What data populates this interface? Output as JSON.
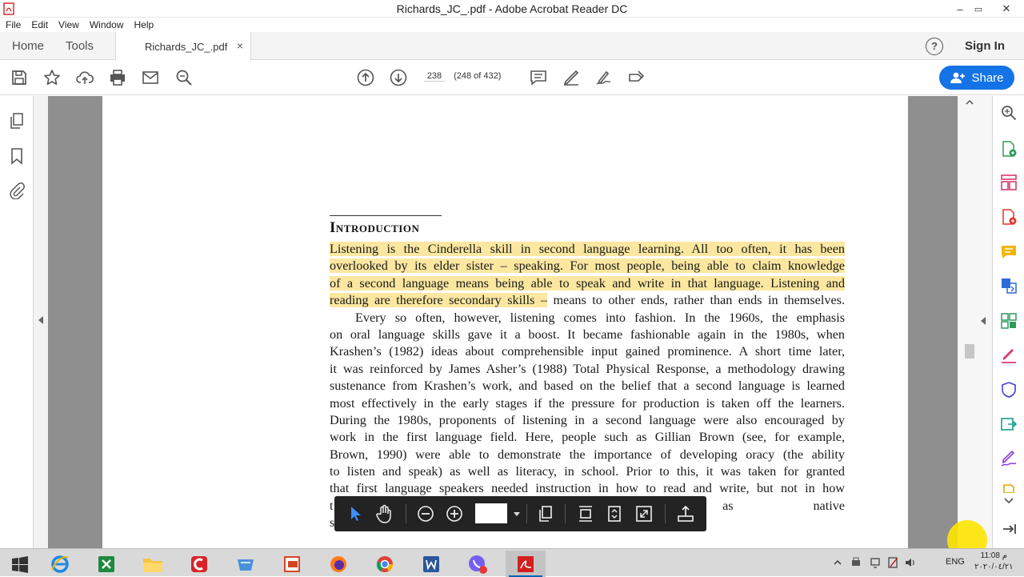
{
  "window": {
    "title": "Richards_JC_.pdf - Adobe Acrobat Reader DC",
    "min_glyph": "–",
    "max_glyph": "▭",
    "close_glyph": "✕"
  },
  "menu": [
    "File",
    "Edit",
    "View",
    "Window",
    "Help"
  ],
  "tabs": {
    "home": "Home",
    "tools": "Tools",
    "doc": "Richards_JC_.pdf",
    "close_glyph": "×"
  },
  "header": {
    "help_glyph": "?",
    "signin": "Sign In",
    "share": "Share"
  },
  "toolbar": {
    "page_current": "238",
    "page_total": "(248 of 432)"
  },
  "document": {
    "heading": "Introduction",
    "lines": [
      {
        "t": "Listening is the Cinderella skill in second language learning. All too often, it has been",
        "hl": true
      },
      {
        "t": "overlooked by its elder sister – speaking. For most people, being able to claim knowledge",
        "hl": true
      },
      {
        "t": "of a second language means being able to speak and write in that language. Listening and",
        "hl": true
      },
      {
        "t": "reading are therefore secondary skills –",
        "hl": true,
        "rest": " means to other ends, rather than ends in themselves."
      },
      {
        "t": "Every so often, however, listening comes into fashion. In the 1960s, the emphasis",
        "indent": true
      },
      {
        "t": "on oral language skills gave it a boost. It became fashionable again in the 1980s, when"
      },
      {
        "t": "Krashen’s (1982) ideas about comprehensible input gained prominence. A short time later,"
      },
      {
        "t": "it was reinforced by James Asher’s (1988) Total Physical Response, a methodology drawing"
      },
      {
        "t": "sustenance from Krashen’s work, and based on the belief that a second language is learned"
      },
      {
        "t": "most effectively in the early stages if the pressure for production is taken off the learners."
      },
      {
        "t": "During the 1980s, proponents of listening in a second language were also encouraged by"
      },
      {
        "t": "work in the first language field. Here, people such as Gillian Brown (see, for example,"
      },
      {
        "t": "Brown, 1990) were able to demonstrate the importance of developing oracy (the ability"
      },
      {
        "t": "to listen and speak) as well as literacy, in school. Prior to this, it was taken for granted"
      },
      {
        "t": "that first language speakers needed instruction in how to read and write, but not in how"
      },
      {
        "t": "t                                                                                                   eathed to them as native"
      },
      {
        "t": "s"
      }
    ]
  },
  "taskbar": {
    "lang": "ENG",
    "time": "11:08 م",
    "date": "٢٠٢٠/٠٤/٢١"
  }
}
